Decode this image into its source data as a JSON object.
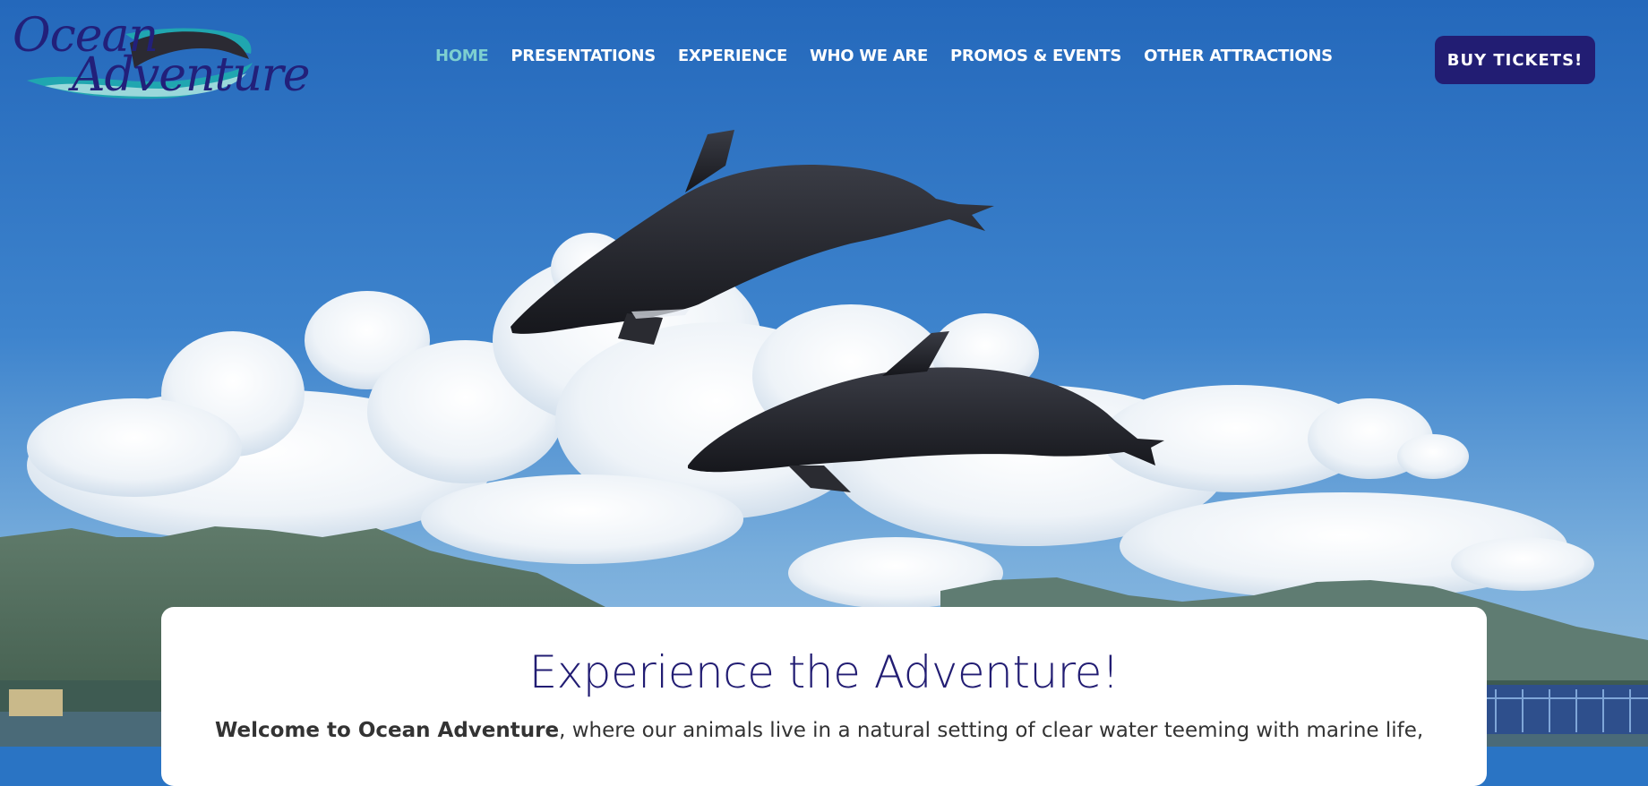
{
  "site": {
    "logo": {
      "line1": "Ocean",
      "line2": "Adventure"
    }
  },
  "nav": {
    "items": [
      {
        "label": "HOME",
        "active": true
      },
      {
        "label": "PRESENTATIONS",
        "active": false
      },
      {
        "label": "EXPERIENCE",
        "active": false
      },
      {
        "label": "WHO WE ARE",
        "active": false
      },
      {
        "label": "PROMOS & EVENTS",
        "active": false
      },
      {
        "label": "OTHER ATTRACTIONS",
        "active": false
      }
    ],
    "cta_label": "BUY TICKETS!"
  },
  "hero": {
    "image": "two bottlenose dolphins leaping against blue sky with clouds and mountains"
  },
  "content": {
    "title": "Experience the Adventure!",
    "intro_bold": "Welcome to Ocean Adventure",
    "intro_rest": ", where our animals live in a natural setting of clear water teeming with marine life,"
  },
  "colors": {
    "brand_navy": "#221d73",
    "nav_active": "#7dcfd0",
    "sky": "#2a74c4",
    "logo_teal": "#20a6b0"
  }
}
